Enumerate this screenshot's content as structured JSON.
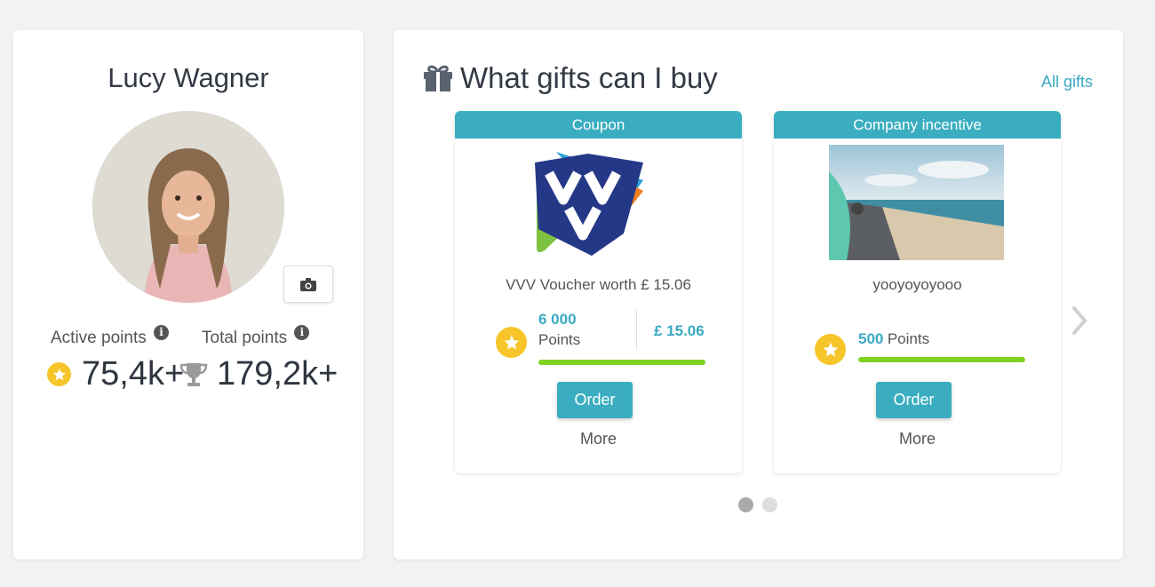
{
  "profile": {
    "name": "Lucy Wagner",
    "active_points_label": "Active points",
    "total_points_label": "Total points",
    "active_points_value": "75,4k+",
    "total_points_value": "179,2k+",
    "info_icon": "i"
  },
  "gifts": {
    "title": "What gifts can I buy",
    "all_gifts_label": "All gifts",
    "cards": [
      {
        "category": "Coupon",
        "title": "VVV Voucher worth £ 15.06",
        "points": "6 000",
        "points_word": "Points",
        "price": "£ 15.06",
        "progress": 1.0,
        "order_label": "Order",
        "more_label": "More"
      },
      {
        "category": "Company incentive",
        "title": "yooyoyoyooo",
        "points": "500",
        "points_word": "Points",
        "progress": 1.0,
        "order_label": "Order",
        "more_label": "More"
      }
    ],
    "pagination": {
      "pages": 2,
      "current": 1
    }
  },
  "colors": {
    "accent": "#3aaec0",
    "progress": "#7ed321",
    "star": "#f7c52a"
  },
  "icons": [
    "camera-icon",
    "info-icon",
    "star-icon",
    "trophy-icon",
    "gift-icon",
    "chevron-right-icon"
  ]
}
